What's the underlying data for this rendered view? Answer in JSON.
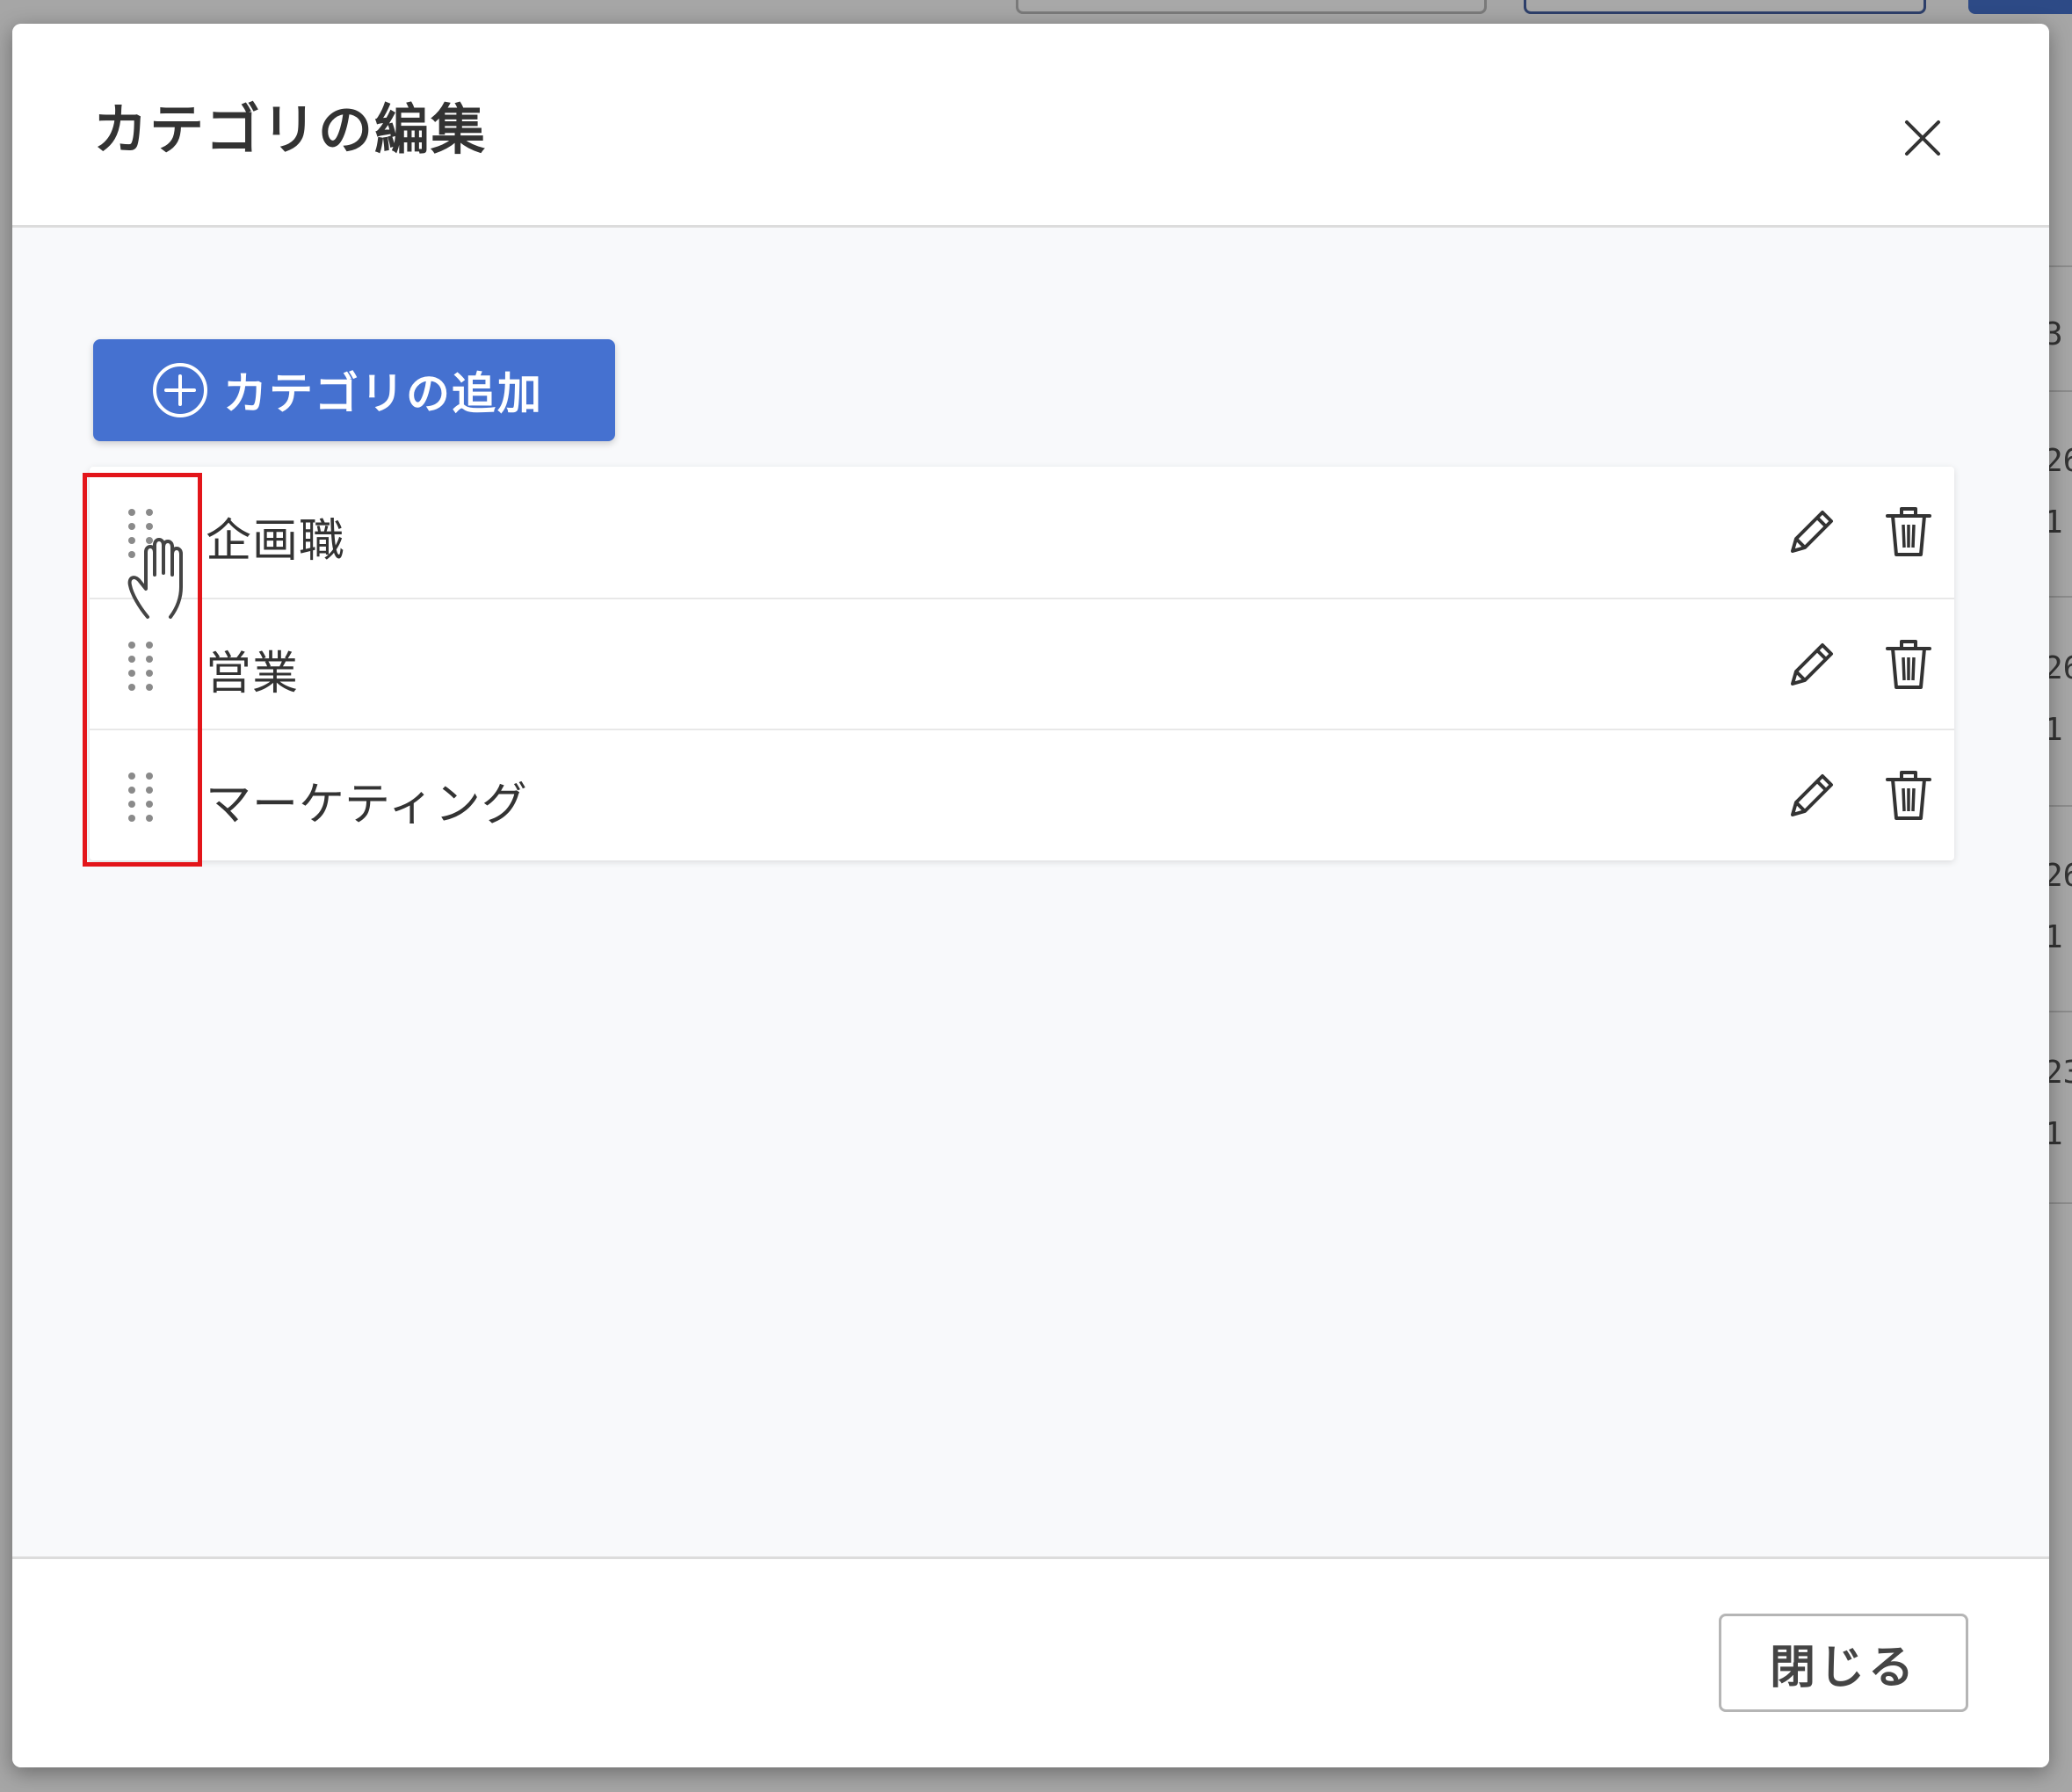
{
  "modal": {
    "title": "カテゴリの編集",
    "close_icon": "close-icon"
  },
  "toolbar": {
    "add_label": "カテゴリの追加",
    "add_icon": "plus-circle-icon"
  },
  "categories": [
    {
      "name": "企画職"
    },
    {
      "name": "営業"
    },
    {
      "name": "マーケティング"
    }
  ],
  "row_icons": {
    "drag": "drag-handle-icon",
    "edit": "pencil-icon",
    "delete": "trash-icon"
  },
  "footer": {
    "close_label": "閉じる"
  },
  "colors": {
    "accent": "#4571d0",
    "highlight": "#e3151a",
    "overlay": "#a6a6a6"
  },
  "background_page": {
    "visible_fragments": [
      "3",
      "26",
      "1",
      "26",
      "1",
      "26",
      "1",
      "23",
      "1"
    ]
  }
}
